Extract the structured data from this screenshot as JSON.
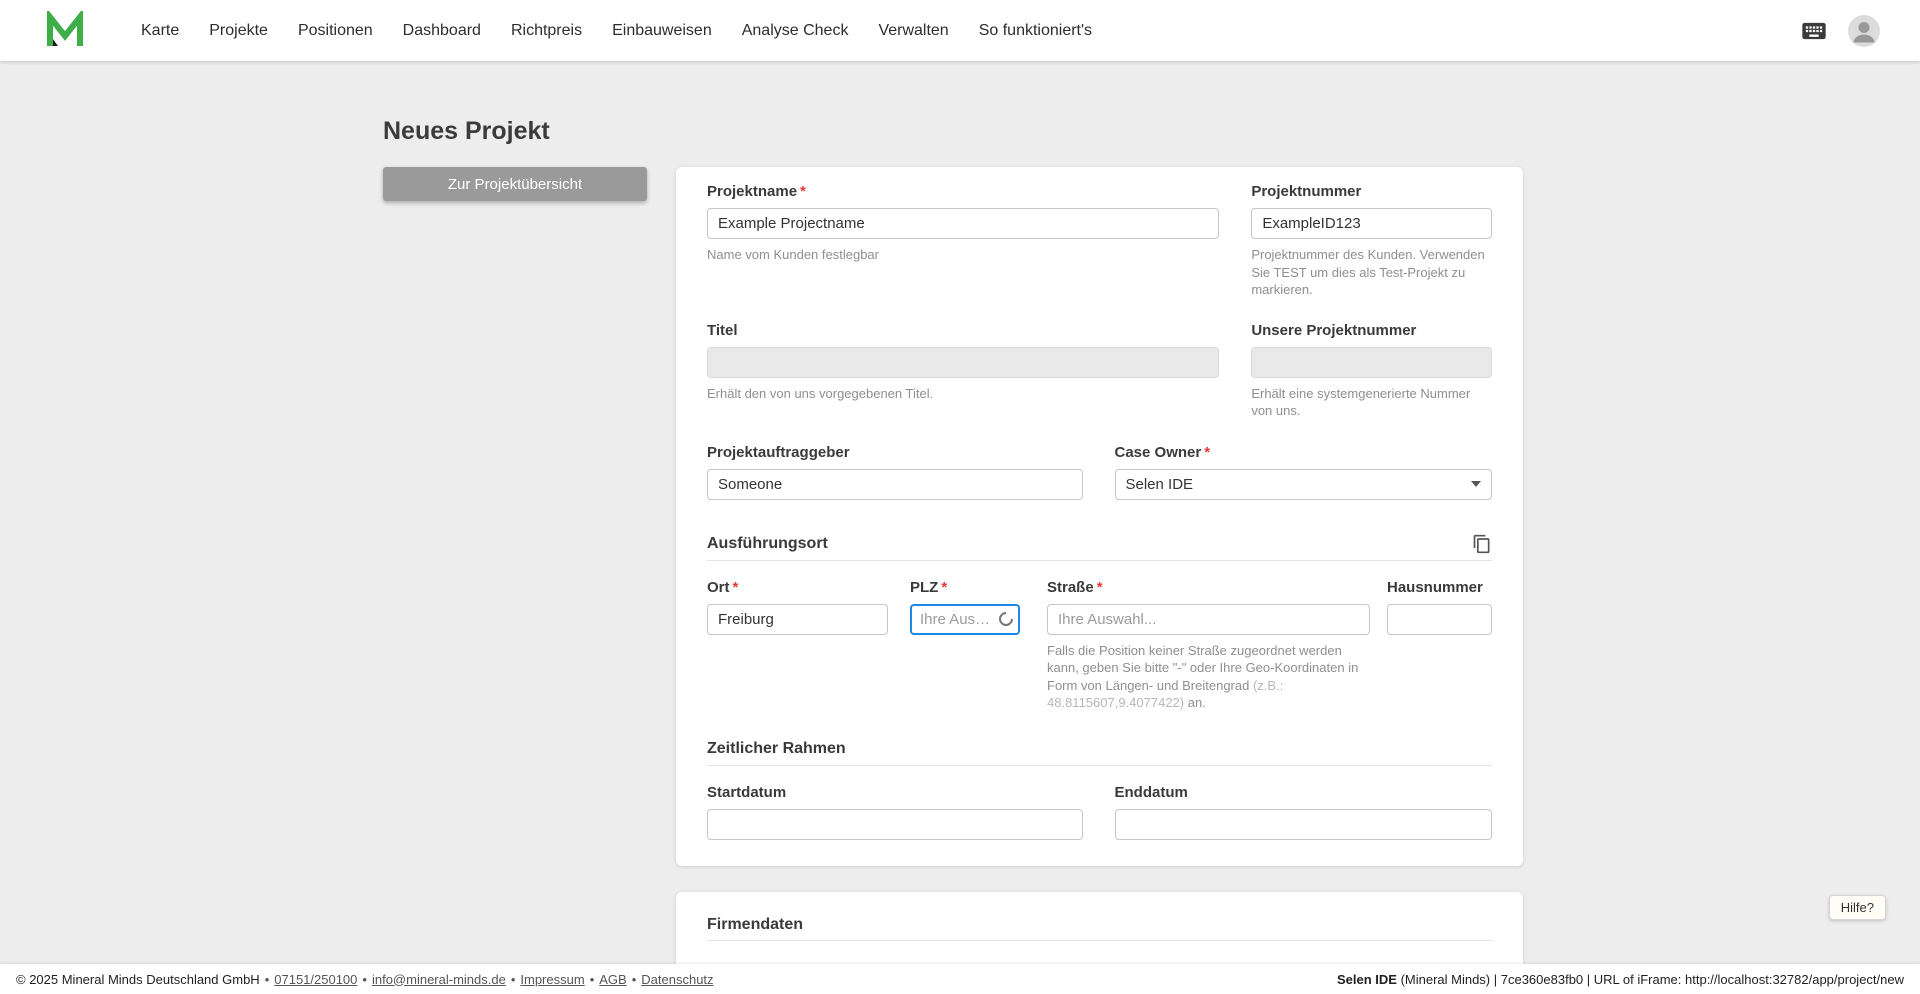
{
  "nav": {
    "items": [
      "Karte",
      "Projekte",
      "Positionen",
      "Dashboard",
      "Richtpreis",
      "Einbauweisen",
      "Analyse Check",
      "Verwalten",
      "So funktioniert's"
    ]
  },
  "icons": {
    "header_right": [
      "keyboard-icon",
      "user-avatar"
    ],
    "ausfuehrungsort_action": "copy-icon",
    "case_owner": "chevron-down-icon",
    "plz_state": "loading-spinner-icon"
  },
  "colors": {
    "accent_blue": "#1e88e5",
    "required_red": "#e53935",
    "button_gray": "#9a9a9a",
    "logo_green": "#3fae49",
    "background": "#ededed"
  },
  "page": {
    "title": "Neues Projekt",
    "back_button": "Zur Projektübersicht"
  },
  "form": {
    "required_marker": "*",
    "projektname": {
      "label": "Projektname",
      "value": "Example Projectname",
      "helper": "Name vom Kunden festlegbar"
    },
    "projektnummer": {
      "label": "Projektnummer",
      "value": "ExampleID123",
      "helper": "Projektnummer des Kunden. Verwenden Sie TEST um dies als Test-Projekt zu markieren."
    },
    "titel": {
      "label": "Titel",
      "value": "",
      "helper": "Erhält den von uns vorgegebenen Titel."
    },
    "unsere_projektnummer": {
      "label": "Unsere Projektnummer",
      "value": "",
      "helper": "Erhält eine systemgenerierte Nummer von uns."
    },
    "projektauftraggeber": {
      "label": "Projektauftraggeber",
      "value": "Someone"
    },
    "case_owner": {
      "label": "Case Owner",
      "value": "Selen IDE"
    },
    "ausfuehrungsort": {
      "heading": "Ausführungsort"
    },
    "ort": {
      "label": "Ort",
      "value": "Freiburg"
    },
    "plz": {
      "label": "PLZ",
      "placeholder": "Ihre Auswa..."
    },
    "strasse": {
      "label": "Straße",
      "placeholder": "Ihre Auswahl...",
      "helper": "Falls die Position keiner Straße zugeordnet werden kann, geben Sie bitte \"-\" oder Ihre Geo-Koordinaten in Form von Längen- und Breitengrad ",
      "helper_example": "(z.B.: 48.8115607,9.4077422)",
      "helper_suffix": " an."
    },
    "hausnummer": {
      "label": "Hausnummer",
      "value": ""
    },
    "zeitlicher_rahmen": {
      "heading": "Zeitlicher Rahmen"
    },
    "startdatum": {
      "label": "Startdatum",
      "value": ""
    },
    "enddatum": {
      "label": "Enddatum",
      "value": ""
    },
    "firmendaten": {
      "heading": "Firmendaten"
    }
  },
  "help": {
    "label": "Hilfe?"
  },
  "footer": {
    "copyright": "© 2025 Mineral Minds Deutschland GmbH",
    "separator": "•",
    "links": [
      {
        "label": "07151/250100"
      },
      {
        "label": "info@mineral-minds.de"
      },
      {
        "label": "Impressum"
      },
      {
        "label": "AGB"
      },
      {
        "label": "Datenschutz"
      }
    ],
    "user": "Selen IDE",
    "session": " (Mineral Minds) | 7ce360e83fb0 | URL of iFrame: http://localhost:32782/app/project/new"
  }
}
